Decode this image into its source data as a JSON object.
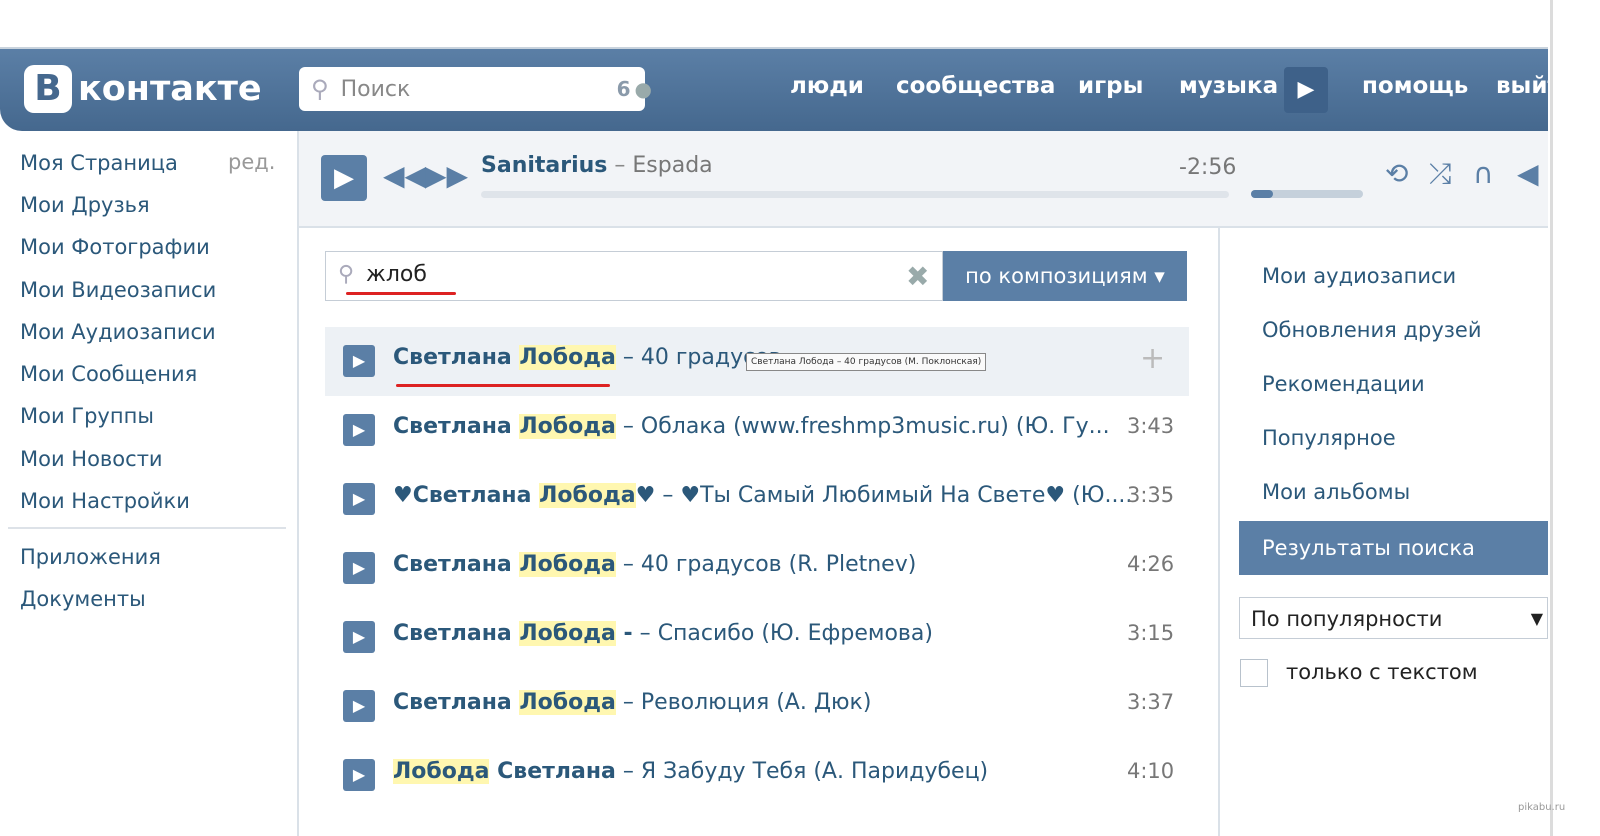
{
  "header": {
    "logo_letter": "В",
    "logo_text": "контакте",
    "search_placeholder": "Поиск",
    "search_count": "6",
    "nav": [
      "люди",
      "сообщества",
      "игры",
      "музыка",
      "помощь",
      "выйти"
    ]
  },
  "sidebar": {
    "items": [
      "Моя Страница",
      "Мои Друзья",
      "Мои Фотографии",
      "Мои Видеозаписи",
      "Мои Аудиозаписи",
      "Мои Сообщения",
      "Мои Группы",
      "Мои Новости",
      "Мои Настройки"
    ],
    "edit": "ред.",
    "extra": [
      "Приложения",
      "Документы"
    ]
  },
  "player": {
    "artist": "Sanitarius",
    "separator": " – ",
    "song": "Espada",
    "time": "-2:56",
    "volume_fraction": 0.2
  },
  "audio_search": {
    "query": "жлоб",
    "button_label": "по композициям ▾"
  },
  "tooltip": "Светлана Лобода – 40 градусов (М. Поклонская)",
  "results": [
    {
      "pre": "Светлана ",
      "hl": "Лобода",
      "post": "",
      "sep": " – ",
      "title": "40 градусов ",
      "dur": "",
      "hover": true
    },
    {
      "pre": "Светлана ",
      "hl": "Лобода",
      "post": "",
      "sep": " – ",
      "title": "Облака (www.freshmp3music.ru) (Ю. Гу...",
      "dur": "3:43"
    },
    {
      "pre": "♥Светлана ",
      "hl": "Лобода",
      "post": "♥",
      "sep": " – ",
      "title": "♥Ты Самый Любимый На Свете♥ (Ю....",
      "dur": "3:35"
    },
    {
      "pre": "Светлана ",
      "hl": "Лобода",
      "post": "",
      "sep": " – ",
      "title": "40 градусов (R. Pletnev)",
      "dur": "4:26"
    },
    {
      "pre": "Светлана ",
      "hl": "Лобода",
      "post": " -",
      "sep": " – ",
      "title": "Спасибо (Ю. Ефремова)",
      "dur": "3:15"
    },
    {
      "pre": "Светлана ",
      "hl": "Лобода",
      "post": "",
      "sep": " – ",
      "title": "Революция (А. Дюк)",
      "dur": "3:37"
    },
    {
      "pre": "",
      "hl": "Лобода",
      "post": " Светлана",
      "sep": " – ",
      "title": "Я Забуду Тебя (А. Паридубец)",
      "dur": "4:10"
    }
  ],
  "right_menu": {
    "items": [
      "Мои аудиозаписи",
      "Обновления друзей",
      "Рекомендации",
      "Популярное",
      "Мои альбомы"
    ],
    "active": "Результаты поиска",
    "sort": "По популярности",
    "checkbox_label": "только с текстом"
  },
  "watermark": "pikabu.ru"
}
